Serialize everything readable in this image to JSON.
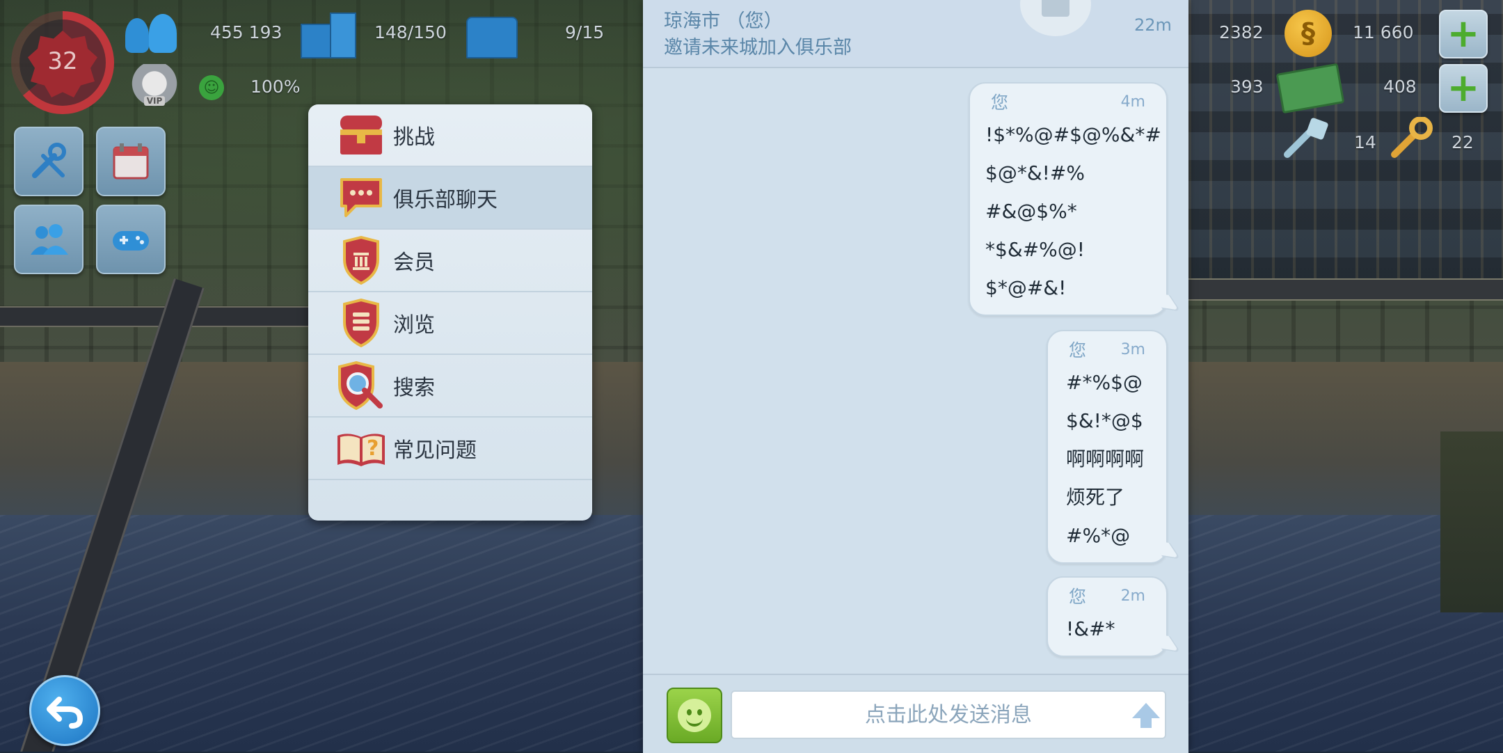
{
  "hud": {
    "level": "32",
    "population": "455 193",
    "storage": "148/150",
    "capacity": "9/15",
    "happiness": "100%",
    "simoleons_income": "2382",
    "simoleons": "11 660",
    "simcash_income": "393",
    "simcash": "408",
    "golden_keys_a": "14",
    "golden_keys_b": "22"
  },
  "menu": {
    "items": [
      {
        "label": "挑战",
        "icon": "treasure-chest-icon"
      },
      {
        "label": "俱乐部聊天",
        "icon": "chat-bubble-icon"
      },
      {
        "label": "会员",
        "icon": "member-shield-icon"
      },
      {
        "label": "浏览",
        "icon": "browse-shield-icon"
      },
      {
        "label": "搜索",
        "icon": "search-shield-icon"
      },
      {
        "label": "常见问题",
        "icon": "faq-book-icon"
      }
    ],
    "active_index": 1
  },
  "chat": {
    "header": {
      "sender": "琼海市 （您）",
      "message": "邀请未来城加入俱乐部",
      "time": "22m"
    },
    "messages": [
      {
        "author": "您",
        "time": "4m",
        "lines": [
          "!$*%@#$@%&*#",
          "$@*&!#%",
          "#&@$%*",
          "*$&#%@!",
          "$*@#&!"
        ]
      },
      {
        "author": "您",
        "time": "3m",
        "lines": [
          "#*%$@",
          "$&!*@$",
          "啊啊啊啊",
          "烦死了",
          "#%*@"
        ]
      },
      {
        "author": "您",
        "time": "2m",
        "lines": [
          "!&#*"
        ]
      }
    ],
    "input_placeholder": "点击此处发送消息"
  },
  "colors": {
    "chat_bg": "#d1e0ec",
    "bubble_bg": "#eaf2f8",
    "accent_green": "#6aaa25",
    "level_red": "#c0373c"
  }
}
